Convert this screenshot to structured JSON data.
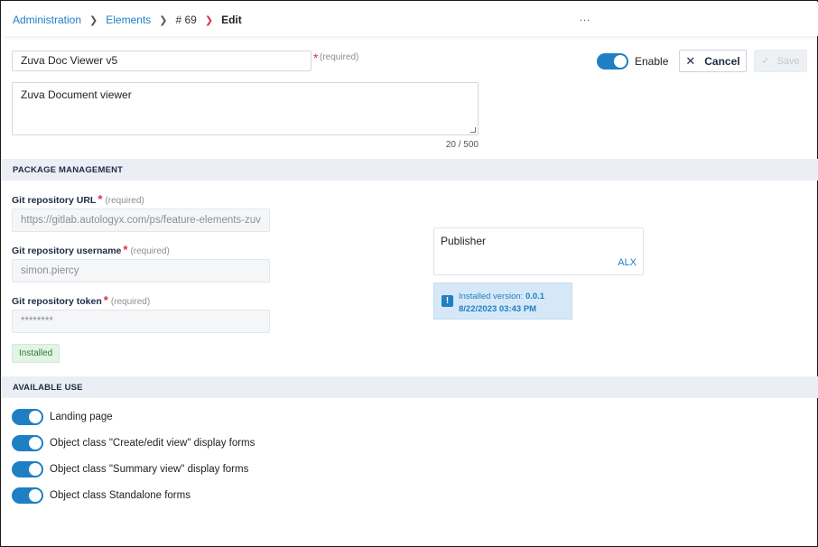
{
  "breadcrumb": {
    "items": [
      "Administration",
      "Elements",
      "# 69"
    ],
    "current": "Edit"
  },
  "header": {
    "more": "..."
  },
  "form": {
    "name_value": "Zuva Doc Viewer v5",
    "required_mark": "*",
    "required_note": "(required)",
    "description_value": "Zuva Document viewer",
    "char_count": "20 / 500"
  },
  "controls": {
    "enable_label": "Enable",
    "enable_on": true,
    "cancel_label": "Cancel",
    "save_label": "Save"
  },
  "package_section": {
    "title": "PACKAGE MANAGEMENT",
    "git_url_label": "Git repository URL",
    "git_url_value": "https://gitlab.autologyx.com/ps/feature-elements-zuv",
    "git_user_label": "Git repository username",
    "git_user_value": "simon.piercy",
    "git_token_label": "Git repository token",
    "git_token_value": "********",
    "required_mark": "*",
    "required_note": "(required)",
    "installed_badge": "Installed",
    "publisher_label": "Publisher",
    "publisher_value": "ALX",
    "info_prefix": "Installed version:",
    "info_version": "0.0.1",
    "info_date": "8/22/2023 03:43 PM"
  },
  "available_use": {
    "title": "AVAILABLE USE",
    "items": [
      {
        "label": "Landing page",
        "on": true
      },
      {
        "label": "Object class \"Create/edit view\" display forms",
        "on": true
      },
      {
        "label": "Object class \"Summary view\" display forms",
        "on": true
      },
      {
        "label": "Object class Standalone forms",
        "on": true
      }
    ]
  },
  "colors": {
    "accent": "#1e7fc4",
    "required": "#d9304c",
    "section_bg": "#ebeff5",
    "installed_bg": "#e3f4e6",
    "info_bg": "#d6e8f7"
  }
}
